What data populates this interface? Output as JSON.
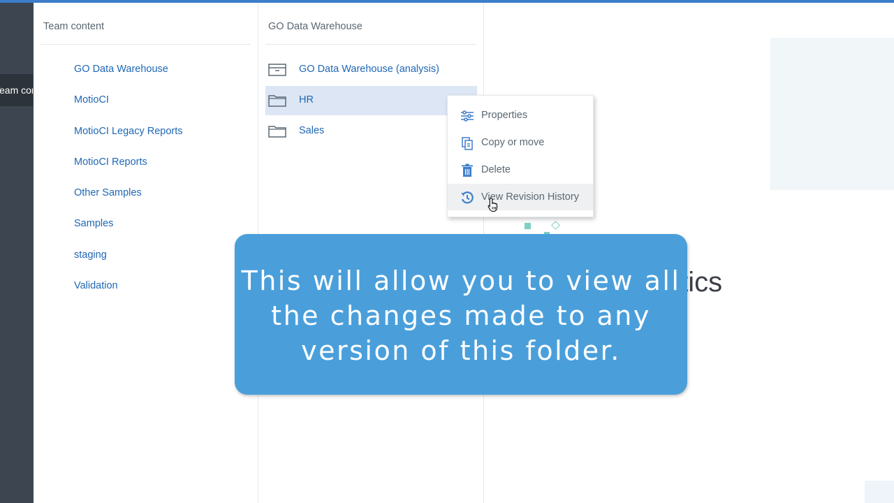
{
  "leftnav": {
    "selected_label": "Team content"
  },
  "team_panel": {
    "title": "Team content",
    "items": [
      "GO Data Warehouse",
      "MotioCI",
      "MotioCI Legacy Reports",
      "MotioCI Reports",
      "Other Samples",
      "Samples",
      "staging",
      "Validation"
    ]
  },
  "folder_panel": {
    "title": "GO Data Warehouse",
    "items": [
      {
        "label": "GO Data Warehouse (analysis)",
        "icon": "package-icon"
      },
      {
        "label": "HR",
        "icon": "folder-icon"
      },
      {
        "label": "Sales",
        "icon": "folder-icon"
      }
    ]
  },
  "context_menu": {
    "items": [
      {
        "label": "Properties",
        "icon": "sliders-icon"
      },
      {
        "label": "Copy or move",
        "icon": "copy-icon"
      },
      {
        "label": "Delete",
        "icon": "trash-icon"
      },
      {
        "label": "View Revision History",
        "icon": "history-icon"
      }
    ]
  },
  "welcome": {
    "title_fragment": "alytics",
    "subtitle_fragment": "!"
  },
  "caption": {
    "text": "This will allow you to view all the changes made to any version of this folder."
  },
  "colors": {
    "accent": "#3d7dca",
    "link": "#1f67b5",
    "caption_bg": "#4a9fdb",
    "selection": "#dce6f5"
  }
}
